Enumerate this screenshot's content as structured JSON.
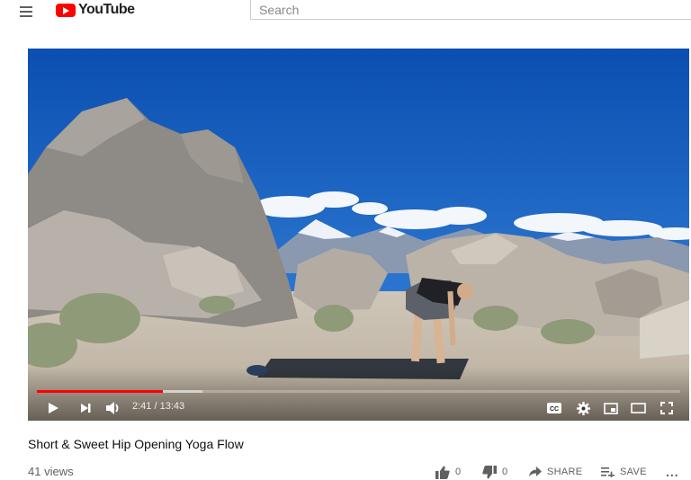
{
  "header": {
    "logo_text": "YouTube",
    "search_placeholder": "Search"
  },
  "player": {
    "current_time": "2:41",
    "duration": "13:43",
    "time_display": "2:41 / 13:43",
    "played_fraction": 0.196,
    "buffered_fraction": 0.258,
    "accent_color": "#ff0000"
  },
  "video": {
    "title": "Short & Sweet Hip Opening Yoga Flow",
    "views": "41 views",
    "like_count": "0",
    "dislike_count": "0",
    "share_label": "SHARE",
    "save_label": "SAVE",
    "more_label": "..."
  }
}
